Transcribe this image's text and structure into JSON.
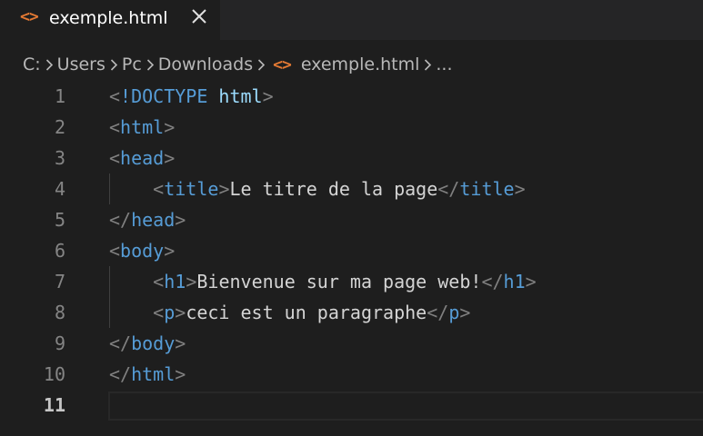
{
  "tab": {
    "icon": "<>",
    "title": "exemple.html"
  },
  "breadcrumb": {
    "items": [
      "C:",
      "Users",
      "Pc",
      "Downloads"
    ],
    "file_icon": "<>",
    "file": "exemple.html",
    "more": "..."
  },
  "editor": {
    "active_line": 11,
    "lines": [
      {
        "number": "1",
        "segments": [
          [
            "b",
            "<"
          ],
          [
            "d",
            "!DOCTYPE"
          ],
          [
            "x",
            " "
          ],
          [
            "h",
            "html"
          ],
          [
            "b",
            ">"
          ]
        ]
      },
      {
        "number": "2",
        "segments": [
          [
            "b",
            "<"
          ],
          [
            "t",
            "html"
          ],
          [
            "b",
            ">"
          ]
        ]
      },
      {
        "number": "3",
        "segments": [
          [
            "b",
            "<"
          ],
          [
            "t",
            "head"
          ],
          [
            "b",
            ">"
          ]
        ]
      },
      {
        "number": "4",
        "segments": [
          [
            "x",
            "    "
          ],
          [
            "b",
            "<"
          ],
          [
            "t",
            "title"
          ],
          [
            "b",
            ">"
          ],
          [
            "x",
            "Le titre de la page"
          ],
          [
            "b",
            "</"
          ],
          [
            "t",
            "title"
          ],
          [
            "b",
            ">"
          ]
        ]
      },
      {
        "number": "5",
        "segments": [
          [
            "b",
            "</"
          ],
          [
            "t",
            "head"
          ],
          [
            "b",
            ">"
          ]
        ]
      },
      {
        "number": "6",
        "segments": [
          [
            "b",
            "<"
          ],
          [
            "t",
            "body"
          ],
          [
            "b",
            ">"
          ]
        ]
      },
      {
        "number": "7",
        "segments": [
          [
            "x",
            "    "
          ],
          [
            "b",
            "<"
          ],
          [
            "t",
            "h1"
          ],
          [
            "b",
            ">"
          ],
          [
            "x",
            "Bienvenue sur ma page web!"
          ],
          [
            "b",
            "</"
          ],
          [
            "t",
            "h1"
          ],
          [
            "b",
            ">"
          ]
        ]
      },
      {
        "number": "8",
        "segments": [
          [
            "x",
            "    "
          ],
          [
            "b",
            "<"
          ],
          [
            "t",
            "p"
          ],
          [
            "b",
            ">"
          ],
          [
            "x",
            "ceci est un paragraphe"
          ],
          [
            "b",
            "</"
          ],
          [
            "t",
            "p"
          ],
          [
            "b",
            ">"
          ]
        ]
      },
      {
        "number": "9",
        "segments": [
          [
            "b",
            "</"
          ],
          [
            "t",
            "body"
          ],
          [
            "b",
            ">"
          ]
        ]
      },
      {
        "number": "10",
        "segments": [
          [
            "b",
            "</"
          ],
          [
            "t",
            "html"
          ],
          [
            "b",
            ">"
          ]
        ]
      },
      {
        "number": "11",
        "segments": []
      }
    ]
  }
}
